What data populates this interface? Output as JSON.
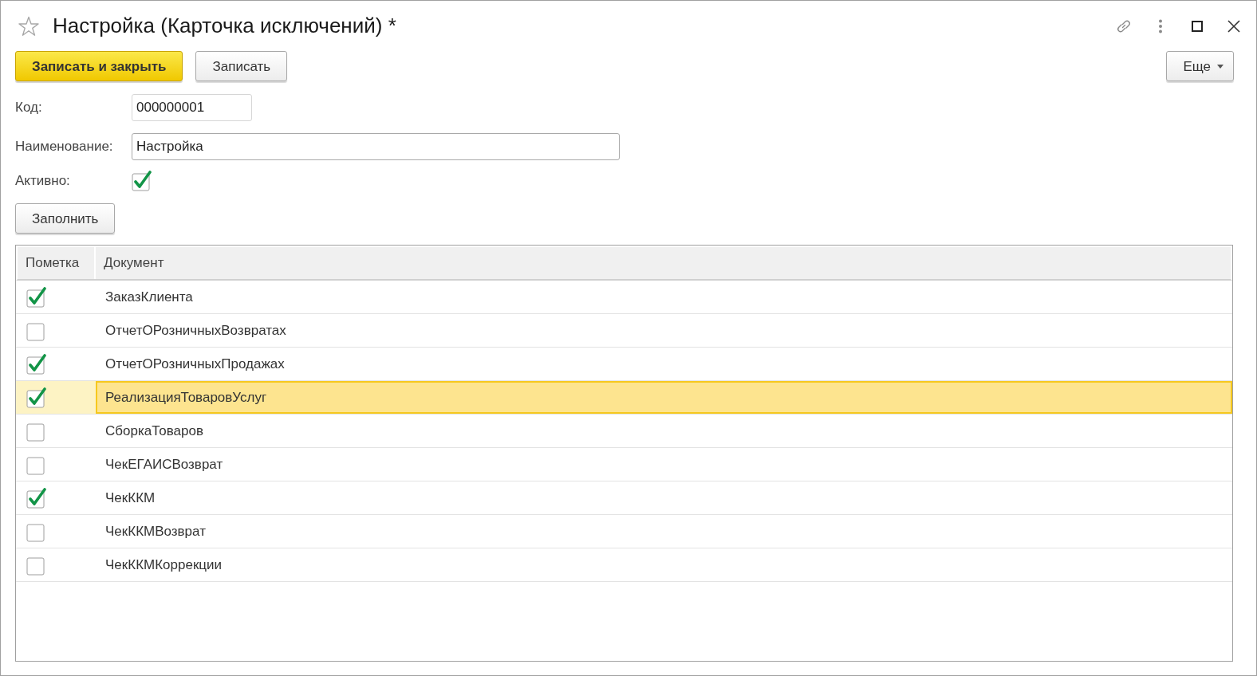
{
  "window": {
    "title": "Настройка (Карточка исключений) *"
  },
  "toolbar": {
    "buttons": [
      {
        "label": "Записать и закрыть",
        "kind": "primary"
      },
      {
        "label": "Записать",
        "kind": "default"
      }
    ],
    "more_button": {
      "label": "Еще"
    }
  },
  "fields": [
    {
      "kind": "text",
      "label": "Код:",
      "value": "000000001"
    },
    {
      "kind": "text",
      "label": "Наименование:",
      "value": "Настройка"
    },
    {
      "kind": "checkbox",
      "label": "Активно:",
      "checked": true
    }
  ],
  "fill_button": {
    "label": "Заполнить"
  },
  "table": {
    "columns": [
      "Пометка",
      "Документ"
    ],
    "rows": [
      {
        "document": "ЗаказКлиента",
        "checked": true,
        "selected": false
      },
      {
        "document": "ОтчетОРозничныхВозвратах",
        "checked": false,
        "selected": false
      },
      {
        "document": "ОтчетОРозничныхПродажах",
        "checked": true,
        "selected": false
      },
      {
        "document": "РеализацияТоваровУслуг",
        "checked": true,
        "selected": true
      },
      {
        "document": "СборкаТоваров",
        "checked": false,
        "selected": false
      },
      {
        "document": "ЧекЕГАИСВозврат",
        "checked": false,
        "selected": false
      },
      {
        "document": "ЧекККМ",
        "checked": true,
        "selected": false
      },
      {
        "document": "ЧекККМВозврат",
        "checked": false,
        "selected": false
      },
      {
        "document": "ЧекККМКоррекции",
        "checked": false,
        "selected": false
      }
    ]
  }
}
